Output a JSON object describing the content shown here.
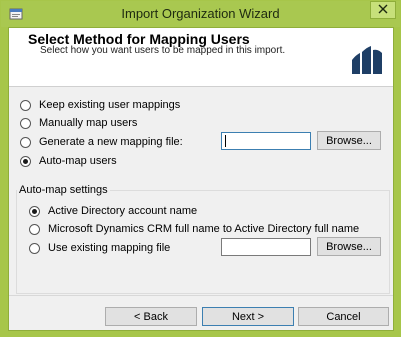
{
  "window": {
    "title": "Import Organization Wizard"
  },
  "header": {
    "title": "Select Method for Mapping Users",
    "subtitle": "Select how you want users to be mapped in this import."
  },
  "mapping_options": [
    {
      "label": "Keep existing user mappings",
      "selected": false
    },
    {
      "label": "Manually map users",
      "selected": false
    },
    {
      "label": "Generate a new mapping file:",
      "selected": false
    },
    {
      "label": "Auto-map users",
      "selected": true
    }
  ],
  "generate_file": {
    "value": "",
    "browse_label": "Browse..."
  },
  "automap": {
    "group_label": "Auto-map settings",
    "options": [
      {
        "label": "Active Directory account name",
        "selected": true
      },
      {
        "label": "Microsoft Dynamics CRM full name to Active Directory full name",
        "selected": false
      },
      {
        "label": "Use existing mapping file",
        "selected": false
      }
    ],
    "existing_file_value": "",
    "browse_label": "Browse..."
  },
  "footer": {
    "back_label": "< Back",
    "next_label": "Next >",
    "cancel_label": "Cancel"
  },
  "icons": {
    "app": "wizard-app-icon",
    "close": "close-icon",
    "logo": "dynamics-crm-logo"
  },
  "colors": {
    "titlebar": "#a9c850",
    "accent": "#3c7fb1",
    "logo": "#1f3f66"
  }
}
